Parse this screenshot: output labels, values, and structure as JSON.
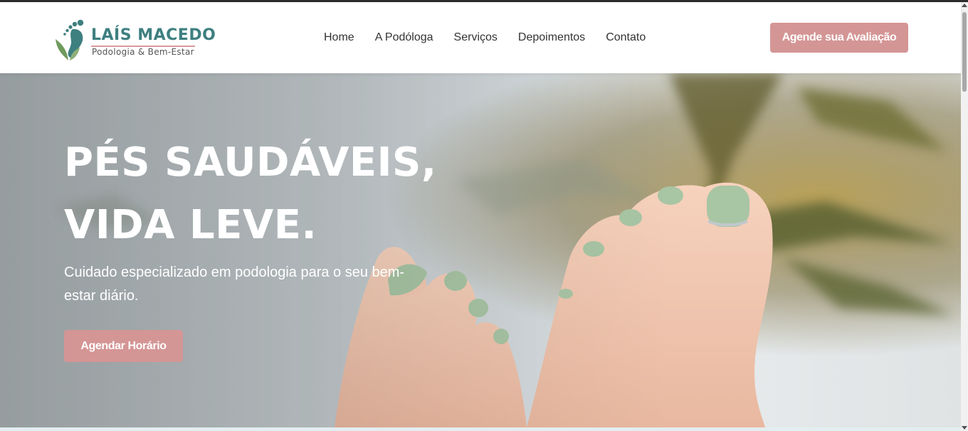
{
  "brand": {
    "title": "LAÍS MACEDO",
    "subtitle": "Podologia & Bem-Estar",
    "logo_icon": "foot-leaf-icon",
    "teal": "#3e7f80",
    "green": "#6f9a5c",
    "rose": "#d99a9a"
  },
  "nav": {
    "items": [
      {
        "label": "Home"
      },
      {
        "label": "A Podóloga"
      },
      {
        "label": "Serviços"
      },
      {
        "label": "Depoimentos"
      },
      {
        "label": "Contato"
      }
    ]
  },
  "header": {
    "cta_label": "Agende sua Avaliação",
    "cta_color": "#d49595"
  },
  "hero": {
    "title_line1": "PÉS SAUDÁVEIS,",
    "title_line2": "VIDA LEVE.",
    "subtitle": "Cuidado especializado em podologia para o seu bem-estar diário.",
    "button_label": "Agendar Horário",
    "image_subject": "feet-with-green-nail-polish-photo",
    "nail_color": "#a8c5a4"
  }
}
